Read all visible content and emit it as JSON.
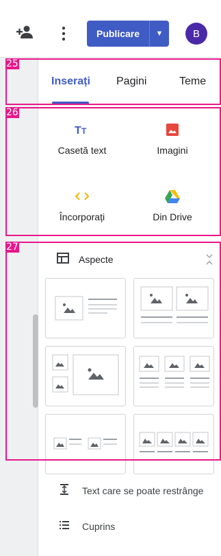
{
  "toolbar": {
    "add_person_icon": "person-add-icon",
    "more_icon": "more-vert-icon",
    "publish_label": "Publicare",
    "publish_menu_icon": "caret-down-icon",
    "avatar_initial": "B",
    "accent_color": "#3f5bc4",
    "avatar_color": "#4a2aa8"
  },
  "tabs": [
    {
      "label": "Inserați",
      "active": true
    },
    {
      "label": "Pagini",
      "active": false
    },
    {
      "label": "Teme",
      "active": false
    }
  ],
  "insert": {
    "items": [
      {
        "label": "Casetă text",
        "icon": "text-box-icon"
      },
      {
        "label": "Imagini",
        "icon": "image-icon"
      },
      {
        "label": "Încorporați",
        "icon": "embed-code-icon"
      },
      {
        "label": "Din Drive",
        "icon": "drive-icon"
      }
    ]
  },
  "layouts": {
    "title": "Aspecte",
    "icon": "layouts-icon",
    "collapse_icon": "collapse-icon",
    "thumbnails": [
      "layout-image-text",
      "layout-two-images-text",
      "layout-image-grid",
      "layout-three-columns",
      "layout-two-image-text-pairs",
      "layout-four-images"
    ]
  },
  "bottom": {
    "items": [
      {
        "label": "Text care se poate restrânge",
        "icon": "collapsible-text-icon"
      },
      {
        "label": "Cuprins",
        "icon": "table-of-contents-icon"
      }
    ]
  },
  "markers": [
    "25",
    "26",
    "27"
  ]
}
